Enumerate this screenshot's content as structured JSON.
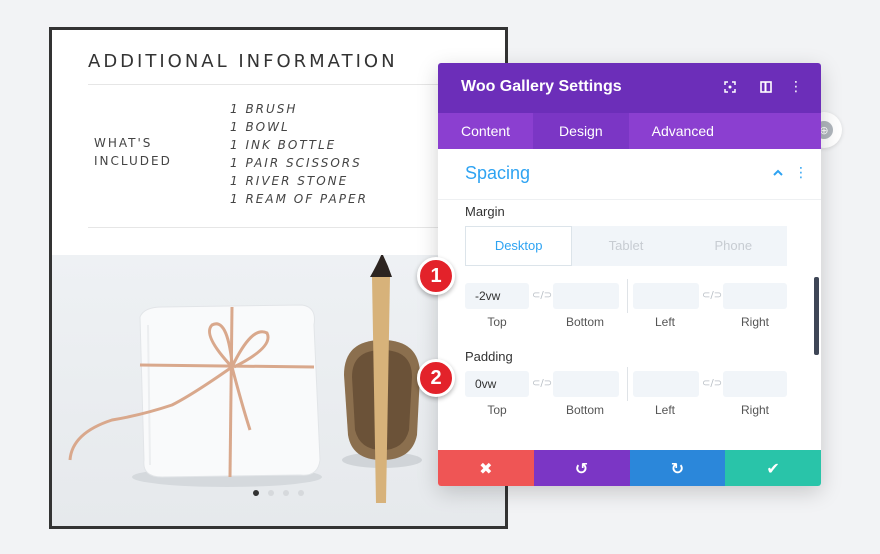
{
  "product": {
    "section_title": "ADDITIONAL INFORMATION",
    "included_label_line1": "WHAT'S",
    "included_label_line2": "INCLUDED",
    "included_items": [
      "1 BRUSH",
      "1 BOWL",
      "1 INK BOTTLE",
      "1 PAIR SCISSORS",
      "1 RIVER STONE",
      "1 REAM OF PAPER"
    ]
  },
  "modal": {
    "title": "Woo Gallery Settings",
    "header_icons": [
      "fullscreen-icon",
      "split-view-icon",
      "more-vertical-icon"
    ],
    "tabs": [
      {
        "label": "Content"
      },
      {
        "label": "Design"
      },
      {
        "label": "Advanced"
      }
    ],
    "active_tab": "Design",
    "section_title": "Spacing",
    "margin": {
      "label": "Margin",
      "device_tabs": [
        "Desktop",
        "Tablet",
        "Phone"
      ],
      "active_device": "Desktop",
      "top": "-2vw",
      "bottom": "",
      "left": "",
      "right": "",
      "labels": [
        "Top",
        "Bottom",
        "Left",
        "Right"
      ]
    },
    "padding": {
      "label": "Padding",
      "top": "0vw",
      "bottom": "",
      "left": "",
      "right": "",
      "labels": [
        "Top",
        "Bottom",
        "Left",
        "Right"
      ]
    },
    "link_glyph": "⊂/⊃",
    "footer_buttons": [
      {
        "name": "cancel",
        "glyph": "✖",
        "color": "#ef5555"
      },
      {
        "name": "undo",
        "glyph": "↺",
        "color": "#7b36c5"
      },
      {
        "name": "redo",
        "glyph": "↻",
        "color": "#2b87da"
      },
      {
        "name": "save",
        "glyph": "✔",
        "color": "#29c4a9"
      }
    ]
  },
  "markers": [
    "1",
    "2"
  ],
  "carousel": {
    "slides": 4,
    "active": 1
  },
  "colors": {
    "header": "#6c2eb9",
    "tabs": "#8b3fd0",
    "accent": "#2ea3f2",
    "marker": "#e3222a"
  }
}
